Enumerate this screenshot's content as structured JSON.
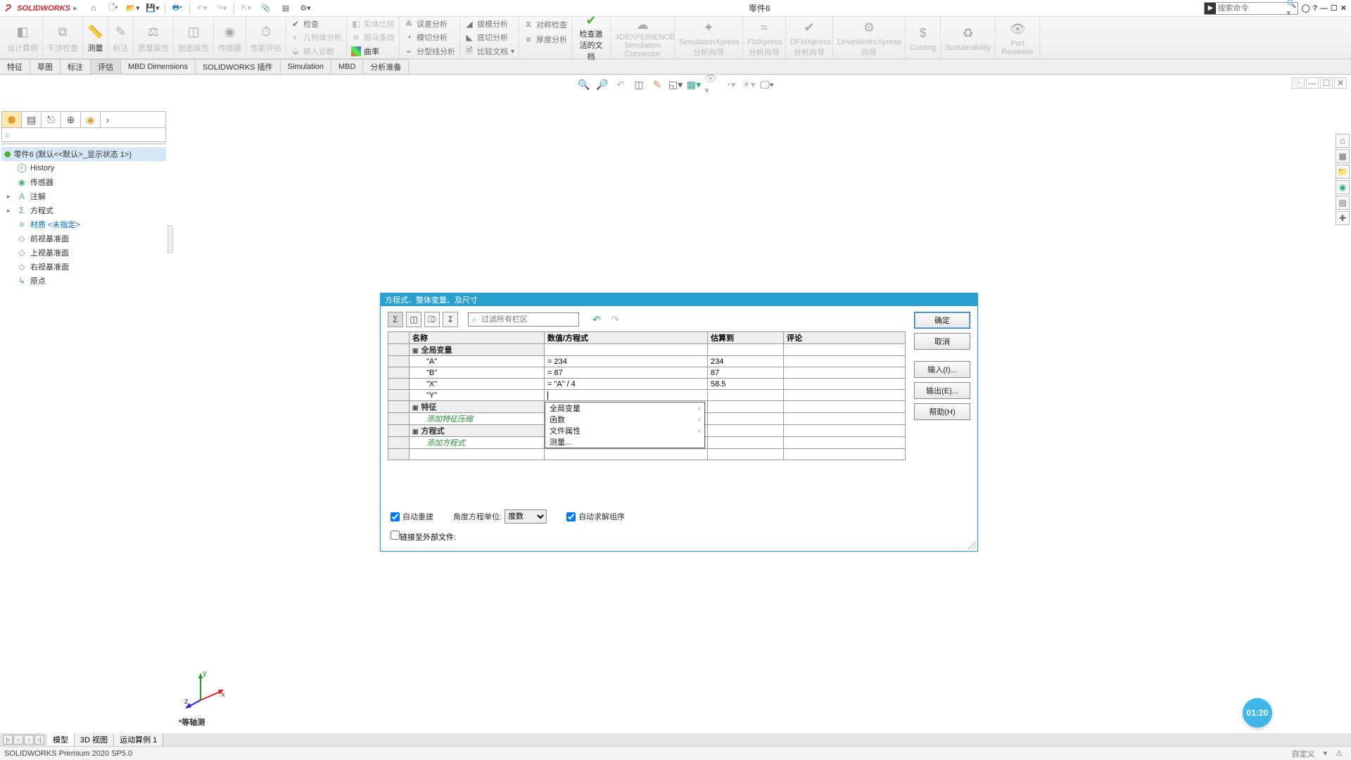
{
  "brand": "SOLIDWORKS",
  "document_title": "零件6",
  "search_placeholder": "搜索命令",
  "ribbon": {
    "groups_big": [
      {
        "label": "设计算例"
      },
      {
        "label": "干涉检查"
      },
      {
        "label": "测量"
      },
      {
        "label": "标注"
      },
      {
        "label": "质量属性"
      },
      {
        "label": "剖面属性"
      },
      {
        "label": "传感器"
      },
      {
        "label": "性能评估"
      }
    ],
    "multi1": {
      "rows": [
        "检查",
        "几何体分析",
        "输入诊断"
      ]
    },
    "multi2": {
      "rows": [
        "实体比较",
        "斑马条纹",
        "曲率"
      ]
    },
    "multi3": {
      "rows": [
        "误差分析",
        "模切分析",
        "分型线分析"
      ]
    },
    "multi4": {
      "rows": [
        "拔模分析",
        "底切分析",
        "比较文档"
      ]
    },
    "multi5": {
      "rows": [
        "对称检查",
        "厚度分析"
      ]
    },
    "activate": "检查激活的文档",
    "right": [
      "3DEXPERIENCE Simulation Connector",
      "SimulationXpress 分析向导",
      "FloXpress 分析向导",
      "DFMXpress 分析向导",
      "DriveWorksXpress 向导",
      "Costing",
      "Sustainability",
      "Part Reviewer"
    ]
  },
  "tabs": [
    "特征",
    "草图",
    "标注",
    "评估",
    "MBD Dimensions",
    "SOLIDWORKS 插件",
    "Simulation",
    "MBD",
    "分析准备"
  ],
  "tabs_active_index": 3,
  "tree": {
    "root": "零件6  (默认<<默认>_显示状态 1>)",
    "items": [
      {
        "label": "History"
      },
      {
        "label": "传感器"
      },
      {
        "label": "注解",
        "expandable": true
      },
      {
        "label": "方程式",
        "expandable": true
      },
      {
        "label": "材质 <未指定>",
        "blue": true
      },
      {
        "label": "前视基准面"
      },
      {
        "label": "上视基准面"
      },
      {
        "label": "右视基准面"
      },
      {
        "label": "原点"
      }
    ]
  },
  "triad_label": "*等轴测",
  "bottom_tabs": [
    "模型",
    "3D 视图",
    "运动算例 1"
  ],
  "status_left": "SOLIDWORKS Premium 2020 SP5.0",
  "status_right": "自定义",
  "timer": "01:20",
  "dialog": {
    "title": "方程式、整体变量、及尺寸",
    "filter_placeholder": "过滤所有栏区",
    "columns": [
      "名称",
      "数值/方程式",
      "估算到",
      "评论"
    ],
    "sections": {
      "globals": "全局变量",
      "features": "特征",
      "equations": "方程式"
    },
    "global_rows": [
      {
        "name": "\"A\"",
        "expr": "= 234",
        "eval": "234"
      },
      {
        "name": "\"B\"",
        "expr": "= 87",
        "eval": "87"
      },
      {
        "name": "\"X\"",
        "expr": "= \"A\" / 4",
        "eval": "58.5"
      },
      {
        "name": "\"Y\"",
        "expr": "",
        "eval": ""
      }
    ],
    "placeholder_features": "添加特征压缩",
    "placeholder_equations": "添加方程式",
    "ac_items": [
      {
        "label": "全局变量",
        "chev": true
      },
      {
        "label": "函数",
        "chev": true
      },
      {
        "label": "文件属性",
        "chev": true
      },
      {
        "label": "测量...",
        "chev": false
      }
    ],
    "buttons": {
      "ok": "确定",
      "cancel": "取消",
      "input": "输入(I)...",
      "output": "输出(E)...",
      "help": "帮助(H)"
    },
    "auto_rebuild": "自动重建",
    "angle_unit_label": "角度方程单位:",
    "angle_unit_value": "度数",
    "auto_solve": "自动求解组序",
    "link_ext": "链接至外部文件:"
  }
}
